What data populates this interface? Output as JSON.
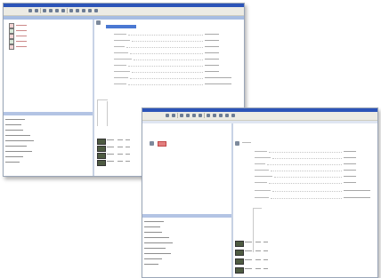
{
  "back_window": {
    "toolbar_buttons": [
      "new-icon",
      "open-icon",
      "save-icon",
      "print-icon",
      "cut-icon",
      "copy-icon",
      "paste-icon",
      "undo-icon",
      "redo-icon",
      "find-icon",
      "help-icon"
    ],
    "tree_items": [
      {
        "icon": "document-icon"
      },
      {
        "icon": "document-icon"
      },
      {
        "icon": "document-icon"
      },
      {
        "icon": "document-icon"
      },
      {
        "icon": "document-icon"
      }
    ],
    "lower_list_count": 9,
    "property_rows": 9,
    "bar_rows": 4
  },
  "front_window": {
    "toolbar_buttons": [
      "new-icon",
      "open-icon",
      "save-icon",
      "print-icon",
      "cut-icon",
      "copy-icon",
      "paste-icon",
      "undo-icon",
      "redo-icon",
      "find-icon",
      "help-icon"
    ],
    "lower_list_count": 9,
    "property_rows": 8,
    "bar_rows": 4
  },
  "colors": {
    "titlebar": "#2c54b8",
    "selection": "#4a78d2",
    "pane_header": "#a7bde2",
    "tree_text": "#c63030",
    "bar_fill": "#4e5b42"
  }
}
